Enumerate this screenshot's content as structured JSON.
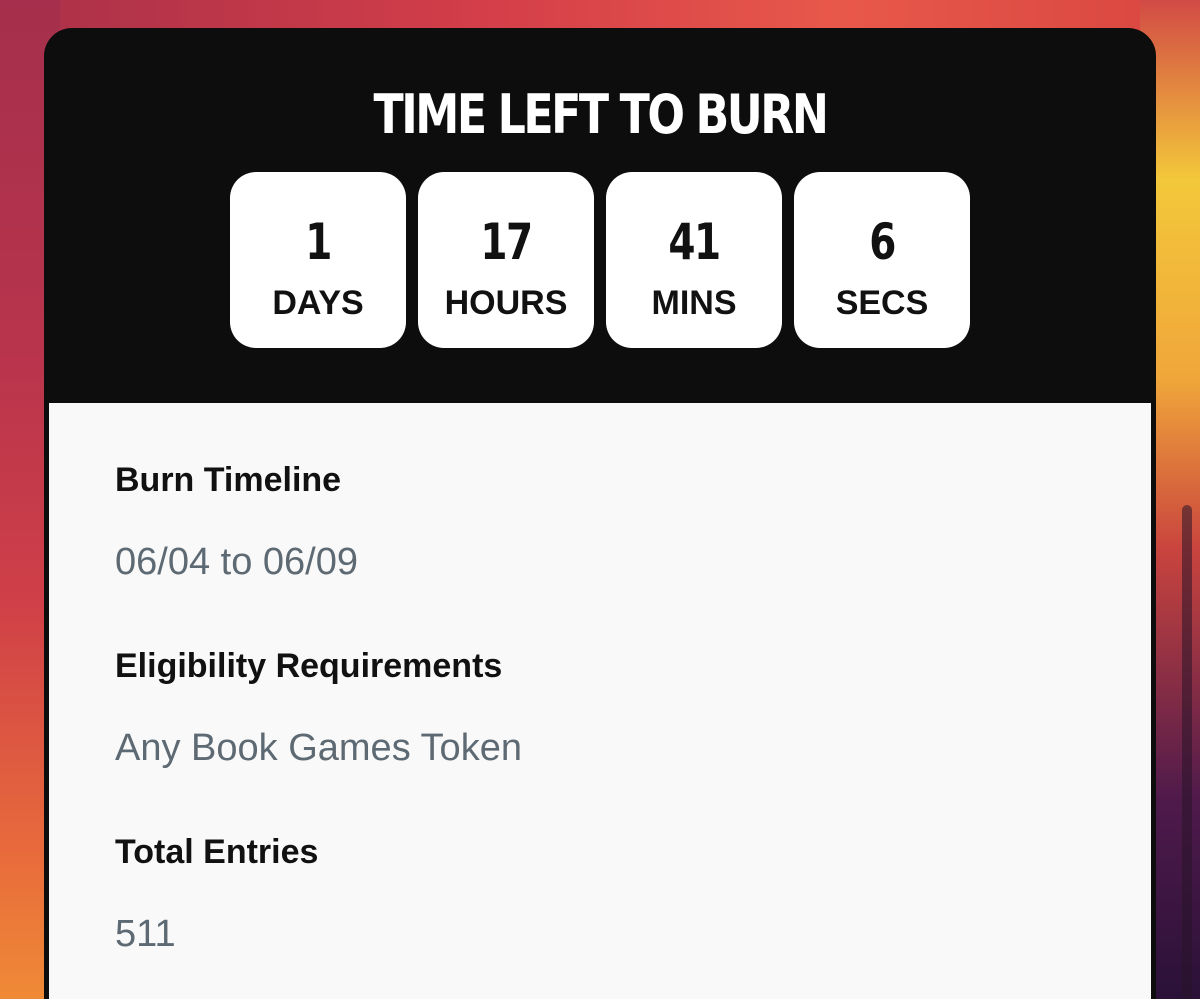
{
  "countdown": {
    "title": "TIME LEFT TO BURN",
    "units": [
      {
        "value": "1",
        "label": "DAYS"
      },
      {
        "value": "17",
        "label": "HOURS"
      },
      {
        "value": "41",
        "label": "MINS"
      },
      {
        "value": "6",
        "label": "SECS"
      }
    ]
  },
  "details": {
    "timeline_label": "Burn Timeline",
    "timeline_value": "06/04 to 06/09",
    "eligibility_label": "Eligibility Requirements",
    "eligibility_value": "Any Book Games Token",
    "entries_label": "Total Entries",
    "entries_value": "511"
  },
  "colors": {
    "card_header_bg": "#0d0d0d",
    "card_body_bg": "#f9f9f9",
    "value_text": "#5e6a73"
  }
}
